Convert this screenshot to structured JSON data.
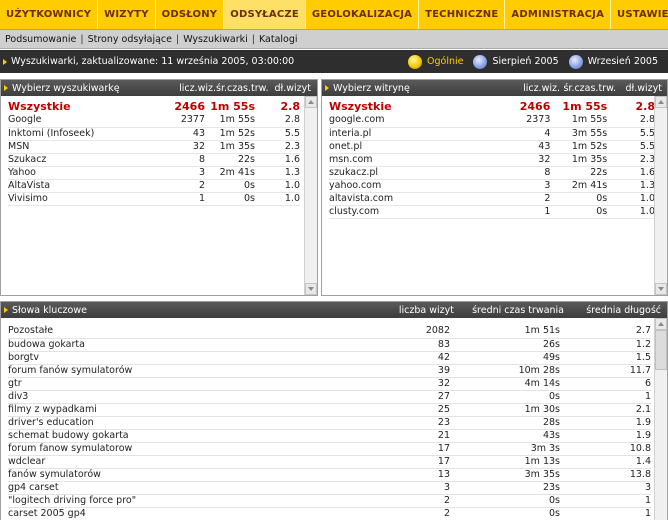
{
  "topnav": [
    "UŻYTKOWNICY",
    "WIZYTY",
    "ODSŁONY",
    "ODSYŁACZE",
    "GEOLOKALIZACJA",
    "TECHNICZNE",
    "ADMINISTRACJA",
    "USTAWIENIA"
  ],
  "active_top": "ODSYŁACZE",
  "subnav": [
    "Podsumowanie",
    "Strony odsyłające",
    "Wyszukiwarki",
    "Katalogi"
  ],
  "active_sub": "Wyszukiwarki",
  "header": {
    "title": "Wyszukiwarki, zaktualizowane: 11 września 2005, 03:00:00",
    "periods": [
      {
        "label": "Ogólnie",
        "active": true
      },
      {
        "label": "Sierpień 2005",
        "active": false
      },
      {
        "label": "Wrzesień 2005",
        "active": false
      }
    ]
  },
  "left_panel": {
    "title": "Wybierz wyszukiwarkę",
    "cols": [
      "licz.wiz.",
      "śr.czas.trw.",
      "dł.wizyt"
    ],
    "all": {
      "name": "Wszystkie",
      "visits": "2466",
      "avg": "1m 55s",
      "len": "2.8"
    },
    "rows": [
      {
        "name": "Google",
        "visits": "2377",
        "avg": "1m 55s",
        "len": "2.8"
      },
      {
        "name": "Inktomi (Infoseek)",
        "visits": "43",
        "avg": "1m 52s",
        "len": "5.5"
      },
      {
        "name": "MSN",
        "visits": "32",
        "avg": "1m 35s",
        "len": "2.3"
      },
      {
        "name": "Szukacz",
        "visits": "8",
        "avg": "22s",
        "len": "1.6"
      },
      {
        "name": "Yahoo",
        "visits": "3",
        "avg": "2m 41s",
        "len": "1.3"
      },
      {
        "name": "AltaVista",
        "visits": "2",
        "avg": "0s",
        "len": "1.0"
      },
      {
        "name": "Vivisimo",
        "visits": "1",
        "avg": "0s",
        "len": "1.0"
      }
    ]
  },
  "right_panel": {
    "title": "Wybierz witrynę",
    "cols": [
      "licz.wiz.",
      "śr.czas.trw.",
      "dł.wizyt"
    ],
    "all": {
      "name": "Wszystkie",
      "visits": "2466",
      "avg": "1m 55s",
      "len": "2.8"
    },
    "rows": [
      {
        "name": "google.com",
        "visits": "2373",
        "avg": "1m 55s",
        "len": "2.8"
      },
      {
        "name": "interia.pl",
        "visits": "4",
        "avg": "3m 55s",
        "len": "5.5"
      },
      {
        "name": "onet.pl",
        "visits": "43",
        "avg": "1m 52s",
        "len": "5.5"
      },
      {
        "name": "msn.com",
        "visits": "32",
        "avg": "1m 35s",
        "len": "2.3"
      },
      {
        "name": "szukacz.pl",
        "visits": "8",
        "avg": "22s",
        "len": "1.6"
      },
      {
        "name": "yahoo.com",
        "visits": "3",
        "avg": "2m 41s",
        "len": "1.3"
      },
      {
        "name": "altavista.com",
        "visits": "2",
        "avg": "0s",
        "len": "1.0"
      },
      {
        "name": "clusty.com",
        "visits": "1",
        "avg": "0s",
        "len": "1.0"
      }
    ]
  },
  "keywords": {
    "title": "Słowa kluczowe",
    "cols": [
      "liczba wizyt",
      "średni czas trwania",
      "średnia długość"
    ],
    "rows": [
      {
        "name": "Pozostałe",
        "visits": "2082",
        "avg": "1m 51s",
        "len": "2.7"
      },
      {
        "name": "budowa gokarta",
        "visits": "83",
        "avg": "26s",
        "len": "1.2"
      },
      {
        "name": "borgtv",
        "visits": "42",
        "avg": "49s",
        "len": "1.5"
      },
      {
        "name": "forum fanów symulatorów",
        "visits": "39",
        "avg": "10m 28s",
        "len": "11.7"
      },
      {
        "name": "gtr",
        "visits": "32",
        "avg": "4m 14s",
        "len": "6"
      },
      {
        "name": "div3",
        "visits": "27",
        "avg": "0s",
        "len": "1"
      },
      {
        "name": "filmy z wypadkami",
        "visits": "25",
        "avg": "1m 30s",
        "len": "2.1"
      },
      {
        "name": "driver's education",
        "visits": "23",
        "avg": "28s",
        "len": "1.9"
      },
      {
        "name": "schemat budowy gokarta",
        "visits": "21",
        "avg": "43s",
        "len": "1.9"
      },
      {
        "name": "forum fanow symulatorow",
        "visits": "17",
        "avg": "3m 3s",
        "len": "10.8"
      },
      {
        "name": "wdclear",
        "visits": "17",
        "avg": "1m 13s",
        "len": "1.4"
      },
      {
        "name": "fanów symulatorów",
        "visits": "13",
        "avg": "3m 35s",
        "len": "13.8"
      },
      {
        "name": "gp4 carset",
        "visits": "3",
        "avg": "23s",
        "len": "3"
      },
      {
        "name": "\"logitech driving force pro\"",
        "visits": "2",
        "avg": "0s",
        "len": "1"
      },
      {
        "name": "carset 2005 gp4",
        "visits": "2",
        "avg": "0s",
        "len": "1"
      }
    ]
  }
}
